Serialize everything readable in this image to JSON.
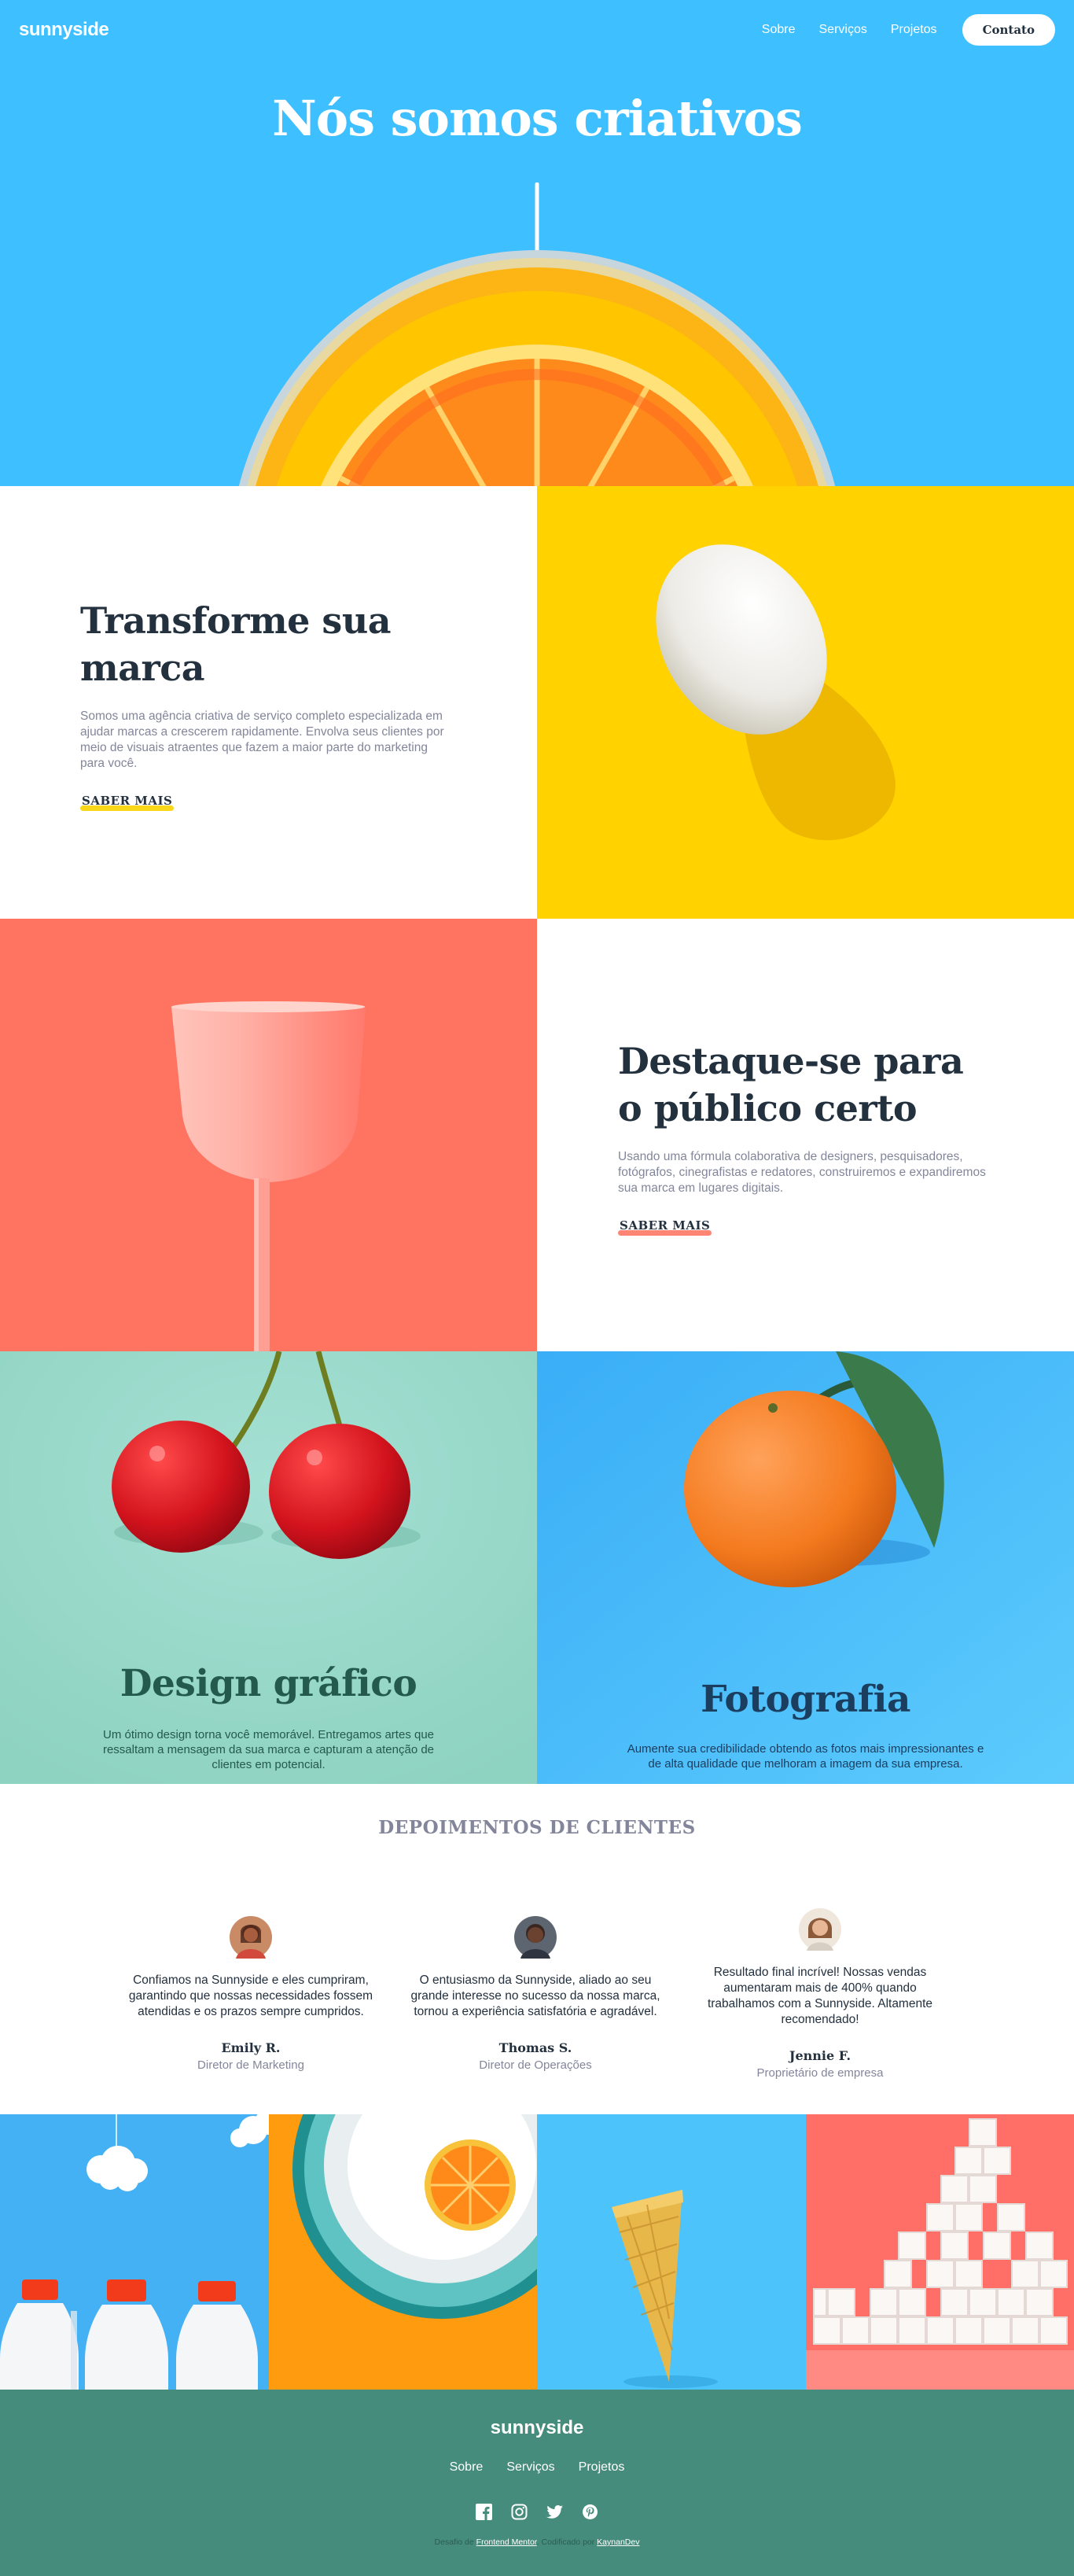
{
  "header": {
    "logo": "sunnyside",
    "nav": [
      {
        "label": "Sobre"
      },
      {
        "label": "Serviços"
      },
      {
        "label": "Projetos"
      }
    ],
    "cta_label": "Contato"
  },
  "hero": {
    "title": "Nós somos criativos",
    "background": "#3ebfff"
  },
  "features": [
    {
      "title": "Transforme sua marca",
      "text": "Somos uma agência criativa de serviço completo especializada em ajudar marcas a crescerem rapidamente. Envolva seus clientes por meio de visuais atraentes que fazem a maior parte do marketing para você.",
      "link_label": "SABER MAIS",
      "accent": "#fad400",
      "image": "egg-icon",
      "image_bg": "#ffd200"
    },
    {
      "title": "Destaque-se para o público certo",
      "text": "Usando uma fórmula colaborativa de designers, pesquisadores, fotógrafos, cinegrafistas e redatores, construiremos e expandiremos sua marca em lugares digitais.",
      "link_label": "SABER MAIS",
      "accent": "#fe7865",
      "image": "glass-icon",
      "image_bg": "#ff7361"
    }
  ],
  "services": [
    {
      "title": "Design gráfico",
      "text": "Um ótimo design torna você memorável. Entregamos artes que ressaltam a mensagem da sua marca e capturam a atenção de clientes em potencial.",
      "image": "cherries-icon",
      "title_color": "#24594e",
      "text_color": "#24594e"
    },
    {
      "title": "Fotografia",
      "text": "Aumente sua credibilidade obtendo as fotos mais impressionantes e de alta qualidade que melhoram a imagem da sua empresa.",
      "image": "orange-icon",
      "title_color": "#1b3d5e",
      "text_color": "#1b3d5e"
    }
  ],
  "testimonials": {
    "heading": "DEPOIMENTOS DE CLIENTES",
    "items": [
      {
        "quote": "Confiamos na Sunnyside e eles cumpriram, garantindo que nossas necessidades fossem atendidas e os prazos sempre cumpridos.",
        "name": "Emily R.",
        "role": "Diretor de Marketing"
      },
      {
        "quote": "O entusiasmo da Sunnyside, aliado ao seu grande interesse no sucesso da nossa marca, tornou a experiência satisfatória e agradável.",
        "name": "Thomas S.",
        "role": "Diretor de Operações"
      },
      {
        "quote": "Resultado final incrível! Nossas vendas aumentaram mais de 400% quando trabalhamos com a Sunnyside. Altamente recomendado!",
        "name": "Jennie F.",
        "role": "Proprietário de empresa"
      }
    ]
  },
  "gallery": [
    {
      "image": "milk-bottles-icon"
    },
    {
      "image": "orange-on-plate-icon"
    },
    {
      "image": "ice-cream-cone-icon"
    },
    {
      "image": "sugar-cubes-icon"
    }
  ],
  "footer": {
    "logo": "sunnyside",
    "nav": [
      {
        "label": "Sobre"
      },
      {
        "label": "Serviços"
      },
      {
        "label": "Projetos"
      }
    ],
    "social": [
      "facebook-icon",
      "instagram-icon",
      "twitter-icon",
      "pinterest-icon"
    ],
    "attribution": {
      "prefix": "Desafio de",
      "link1": "Frontend Mentor",
      "middle": ". Codificado por",
      "link2": "KaynanDev"
    }
  }
}
